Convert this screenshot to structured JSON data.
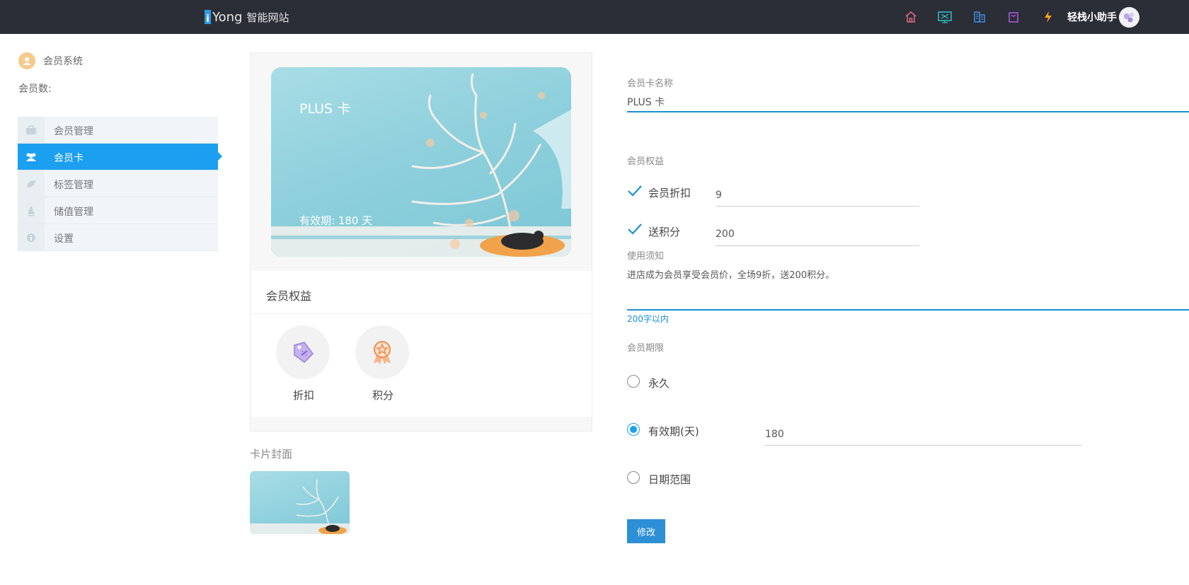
{
  "header": {
    "logo_mark": "i",
    "logo_text": "Yong",
    "logo_sub": "智能网站",
    "nav_icons": [
      "home-icon",
      "monitor-icon",
      "building-icon",
      "bag-icon",
      "lightning-icon"
    ],
    "assistant_label": "轻栈小助手"
  },
  "sidebar": {
    "system_title": "会员系统",
    "member_count_label": "会员数:",
    "items": [
      {
        "label": "会员管理",
        "icon": "briefcase-icon",
        "active": false
      },
      {
        "label": "会员卡",
        "icon": "users-icon",
        "active": true
      },
      {
        "label": "标签管理",
        "icon": "leaf-icon",
        "active": false
      },
      {
        "label": "储值管理",
        "icon": "fire-icon",
        "active": false
      },
      {
        "label": "设置",
        "icon": "info-icon",
        "active": false
      }
    ]
  },
  "preview": {
    "card_title": "PLUS 卡",
    "card_validity": "有效期:  180 天",
    "benefits_title": "会员权益",
    "benefits": [
      {
        "label": "折扣",
        "icon": "discount-tag-icon"
      },
      {
        "label": "积分",
        "icon": "medal-icon"
      }
    ],
    "cover_title": "卡片封面"
  },
  "form": {
    "card_name_label": "会员卡名称",
    "card_name_value": "PLUS 卡",
    "benefits_label": "会员权益",
    "discount_label": "会员折扣",
    "discount_value": "9",
    "points_label": "送积分",
    "points_value": "200",
    "notice_label": "使用须知",
    "notice_value": "进店成为会员享受会员价，全场9折，送200积分。",
    "notice_hint": "200字以内",
    "period_label": "会员期限",
    "period_options": [
      "永久",
      "有效期(天)",
      "日期范围"
    ],
    "period_selected": "有效期(天)",
    "validity_days": "180",
    "submit_label": "修改"
  },
  "colors": {
    "topbar": "#2b2d37",
    "accent": "#1b9ff0",
    "button": "#2d8fd5"
  }
}
